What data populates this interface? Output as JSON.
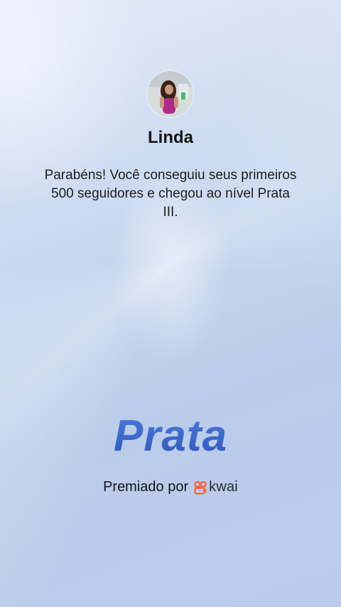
{
  "profile": {
    "name": "Linda"
  },
  "message": {
    "text": "Parabéns! Você conseguiu seus primeiros 500 seguidores e chegou ao nível Prata III."
  },
  "level": {
    "title": "Prata"
  },
  "award": {
    "prefix": "Premiado por",
    "brand": "kwai",
    "brand_icon": "kwai-logo-icon"
  },
  "colors": {
    "level_accent": "#3a63c9",
    "brand_accent": "#ff5b2e"
  }
}
